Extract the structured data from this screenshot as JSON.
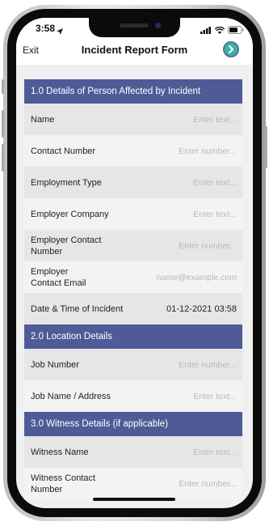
{
  "status_bar": {
    "time": "3:58"
  },
  "nav": {
    "exit_label": "Exit",
    "title": "Incident Report Form"
  },
  "sections": [
    {
      "title": "1.0 Details of Person Affected by Incident"
    },
    {
      "title": "2.0 Location Details"
    },
    {
      "title": "3.0 Witness Details (if applicable)"
    }
  ],
  "fields": {
    "name": {
      "label": "Name",
      "placeholder": "Enter text..."
    },
    "contact_number": {
      "label": "Contact Number",
      "placeholder": "Enter number..."
    },
    "employment_type": {
      "label": "Employment Type",
      "placeholder": "Enter text..."
    },
    "employer_company": {
      "label": "Employer Company",
      "placeholder": "Enter text..."
    },
    "employer_contact_number": {
      "label_line1": "Employer Contact",
      "label_line2": "Number",
      "placeholder": "Enter number..."
    },
    "employer_contact_email": {
      "label_line1": "Employer",
      "label_line2": "Contact Email",
      "placeholder": "name@example.com"
    },
    "incident_datetime": {
      "label": "Date & Time of Incident",
      "value": "01-12-2021 03:58"
    },
    "job_number": {
      "label": "Job Number",
      "placeholder": "Enter number..."
    },
    "job_name_address": {
      "label": "Job Name / Address",
      "placeholder": "Enter text..."
    },
    "witness_name": {
      "label": "Witness Name",
      "placeholder": "Enter text..."
    },
    "witness_contact_number": {
      "label_line1": "Witness Contact",
      "label_line2": "Number",
      "placeholder": "Enter number..."
    }
  },
  "colors": {
    "section_header": "#4f5b96",
    "next_button": "#35b7a6"
  },
  "icons": {
    "location_arrow": "location-arrow-icon",
    "signal": "signal-icon",
    "wifi": "wifi-icon",
    "battery": "battery-icon",
    "next": "chevron-right-icon"
  }
}
